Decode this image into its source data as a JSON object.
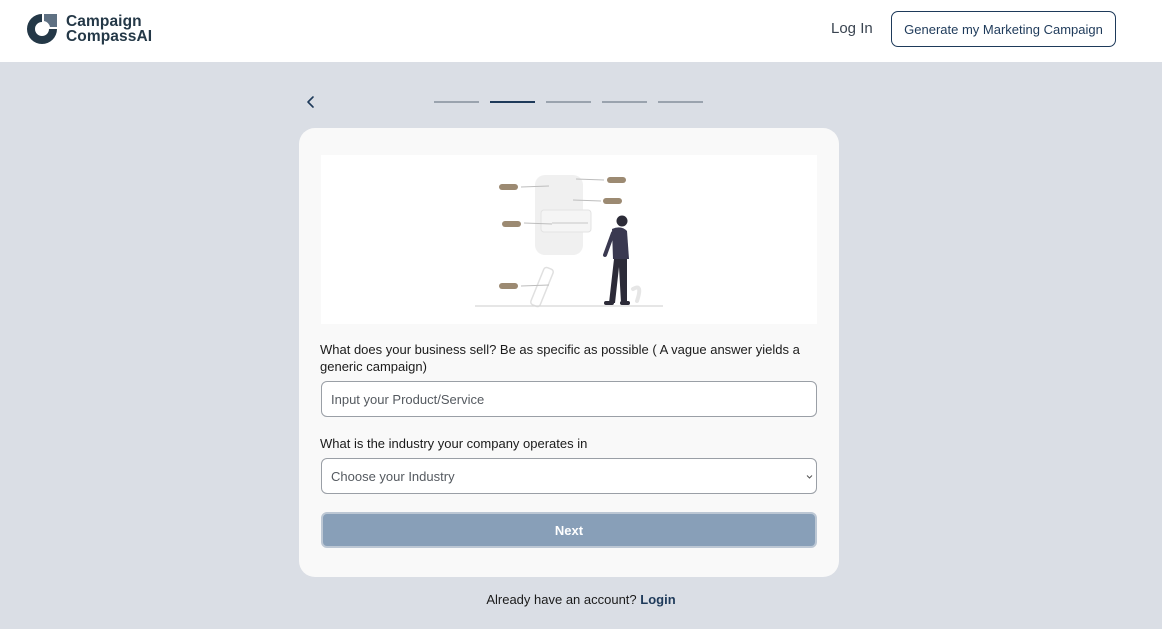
{
  "header": {
    "logo_line1": "Campaign",
    "logo_line2": "CompassAI",
    "login_label": "Log In",
    "cta_label": "Generate my Marketing Campaign"
  },
  "progress": {
    "total_steps": 5,
    "current_step": 2
  },
  "form": {
    "question1": "What does your business sell? Be as specific as possible ( A vague answer yields a generic campaign)",
    "product_placeholder": "Input your Product/Service",
    "question2": "What is the industry your company operates in",
    "industry_selected": "Choose your Industry",
    "next_label": "Next"
  },
  "footer": {
    "prompt": "Already have an account?",
    "login_link": "Login"
  },
  "colors": {
    "brand": "#1e3a5a",
    "page_bg": "#dadee5",
    "next_button": "#889fb8"
  }
}
